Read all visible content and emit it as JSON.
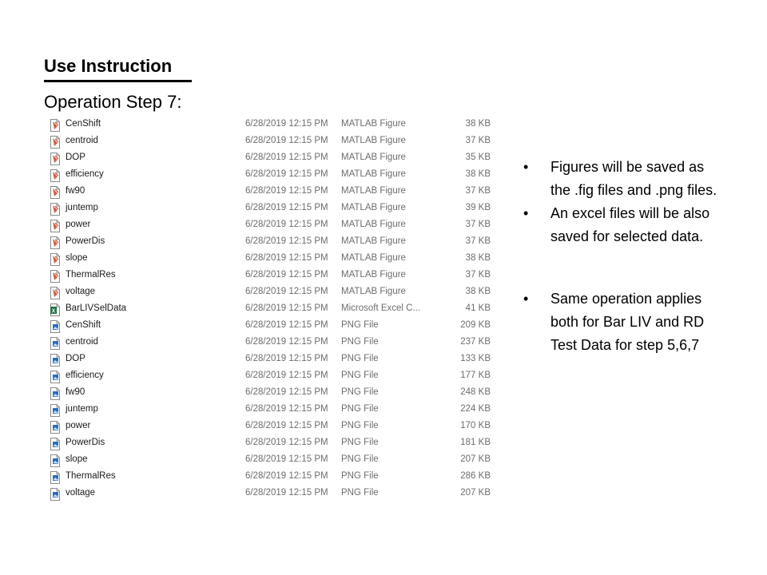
{
  "slide": {
    "title": "Use Instruction",
    "subtitle": "Operation Step 7:"
  },
  "files": [
    {
      "name": "CenShift",
      "date": "6/28/2019 12:15 PM",
      "type": "MATLAB Figure",
      "size": "38 KB",
      "icon": "matlab-fig-icon"
    },
    {
      "name": "centroid",
      "date": "6/28/2019 12:15 PM",
      "type": "MATLAB Figure",
      "size": "37 KB",
      "icon": "matlab-fig-icon"
    },
    {
      "name": "DOP",
      "date": "6/28/2019 12:15 PM",
      "type": "MATLAB Figure",
      "size": "35 KB",
      "icon": "matlab-fig-icon"
    },
    {
      "name": "efficiency",
      "date": "6/28/2019 12:15 PM",
      "type": "MATLAB Figure",
      "size": "38 KB",
      "icon": "matlab-fig-icon"
    },
    {
      "name": "fw90",
      "date": "6/28/2019 12:15 PM",
      "type": "MATLAB Figure",
      "size": "37 KB",
      "icon": "matlab-fig-icon"
    },
    {
      "name": "juntemp",
      "date": "6/28/2019 12:15 PM",
      "type": "MATLAB Figure",
      "size": "39 KB",
      "icon": "matlab-fig-icon"
    },
    {
      "name": "power",
      "date": "6/28/2019 12:15 PM",
      "type": "MATLAB Figure",
      "size": "37 KB",
      "icon": "matlab-fig-icon"
    },
    {
      "name": "PowerDis",
      "date": "6/28/2019 12:15 PM",
      "type": "MATLAB Figure",
      "size": "37 KB",
      "icon": "matlab-fig-icon"
    },
    {
      "name": "slope",
      "date": "6/28/2019 12:15 PM",
      "type": "MATLAB Figure",
      "size": "38 KB",
      "icon": "matlab-fig-icon"
    },
    {
      "name": "ThermalRes",
      "date": "6/28/2019 12:15 PM",
      "type": "MATLAB Figure",
      "size": "37 KB",
      "icon": "matlab-fig-icon"
    },
    {
      "name": "voltage",
      "date": "6/28/2019 12:15 PM",
      "type": "MATLAB Figure",
      "size": "38 KB",
      "icon": "matlab-fig-icon"
    },
    {
      "name": "BarLIVSelData",
      "date": "6/28/2019 12:15 PM",
      "type": "Microsoft Excel C...",
      "size": "41 KB",
      "icon": "excel-csv-icon"
    },
    {
      "name": "CenShift",
      "date": "6/28/2019 12:15 PM",
      "type": "PNG File",
      "size": "209 KB",
      "icon": "png-file-icon"
    },
    {
      "name": "centroid",
      "date": "6/28/2019 12:15 PM",
      "type": "PNG File",
      "size": "237 KB",
      "icon": "png-file-icon"
    },
    {
      "name": "DOP",
      "date": "6/28/2019 12:15 PM",
      "type": "PNG File",
      "size": "133 KB",
      "icon": "png-file-icon"
    },
    {
      "name": "efficiency",
      "date": "6/28/2019 12:15 PM",
      "type": "PNG File",
      "size": "177 KB",
      "icon": "png-file-icon"
    },
    {
      "name": "fw90",
      "date": "6/28/2019 12:15 PM",
      "type": "PNG File",
      "size": "248 KB",
      "icon": "png-file-icon"
    },
    {
      "name": "juntemp",
      "date": "6/28/2019 12:15 PM",
      "type": "PNG File",
      "size": "224 KB",
      "icon": "png-file-icon"
    },
    {
      "name": "power",
      "date": "6/28/2019 12:15 PM",
      "type": "PNG File",
      "size": "170 KB",
      "icon": "png-file-icon"
    },
    {
      "name": "PowerDis",
      "date": "6/28/2019 12:15 PM",
      "type": "PNG File",
      "size": "181 KB",
      "icon": "png-file-icon"
    },
    {
      "name": "slope",
      "date": "6/28/2019 12:15 PM",
      "type": "PNG File",
      "size": "207 KB",
      "icon": "png-file-icon"
    },
    {
      "name": "ThermalRes",
      "date": "6/28/2019 12:15 PM",
      "type": "PNG File",
      "size": "286 KB",
      "icon": "png-file-icon"
    },
    {
      "name": "voltage",
      "date": "6/28/2019 12:15 PM",
      "type": "PNG File",
      "size": "207 KB",
      "icon": "png-file-icon"
    }
  ],
  "notes": {
    "bullet": "•",
    "group1": [
      {
        "line1": "Figures will be saved as",
        "line2": "the .fig files and .png files."
      },
      {
        "line1": "An excel files will be also",
        "line2": "saved for selected data."
      }
    ],
    "group2": [
      {
        "line1": "Same operation applies",
        "line2": "both for Bar LIV and RD",
        "line3": "Test Data for step 5,6,7"
      }
    ]
  },
  "colors": {
    "matlab_icon": "#c8452b",
    "excel_icon": "#1e7145",
    "png_icon": "#2a6ebb",
    "detail_text": "#6d6d6d"
  }
}
